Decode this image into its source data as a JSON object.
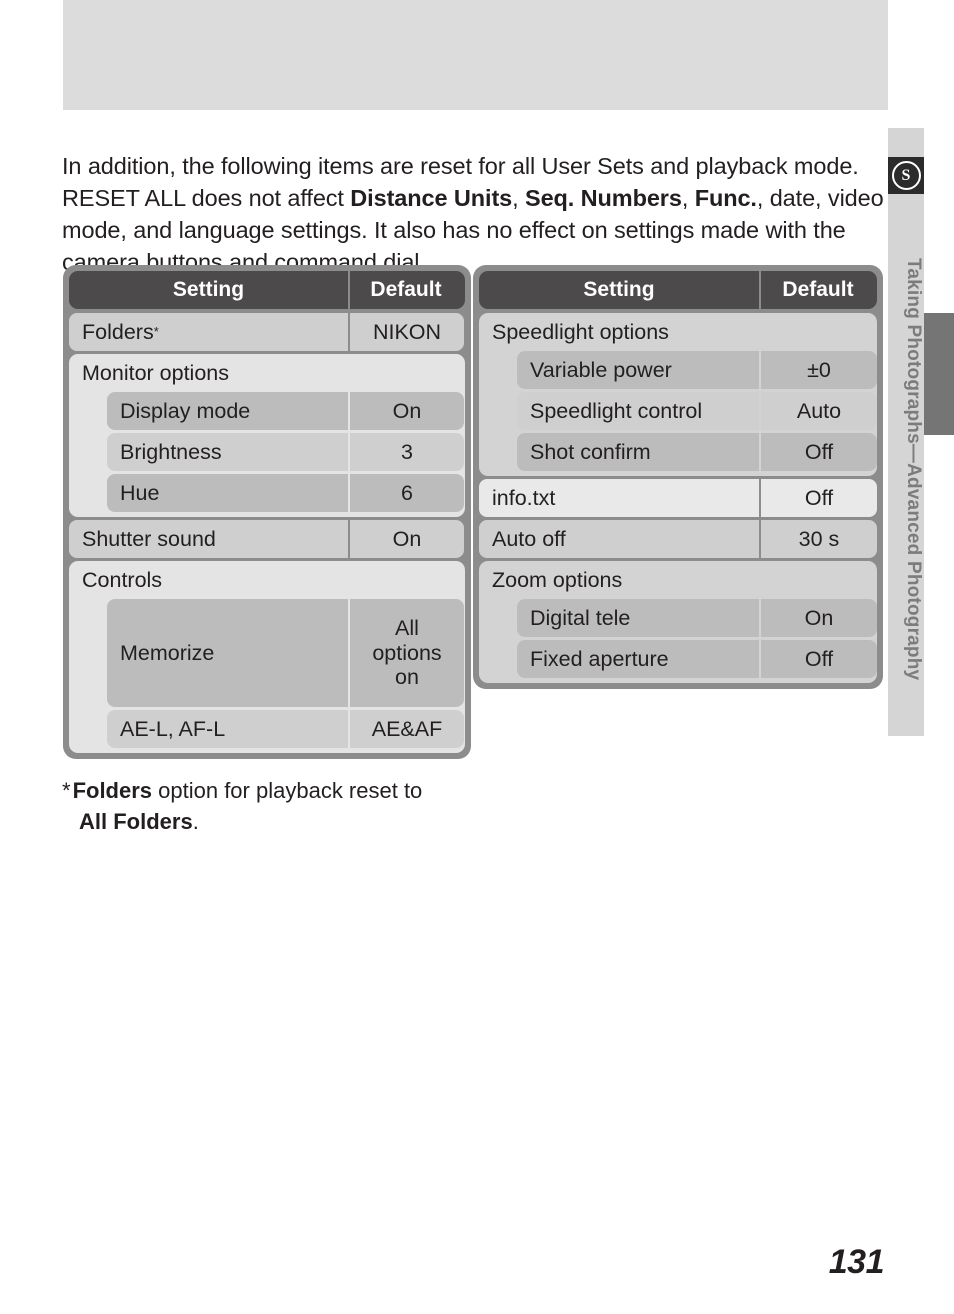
{
  "page": {
    "number": "131",
    "side_tab": {
      "icon": "shutter-s-icon",
      "icon_glyph": "S",
      "label": "Taking Photographs—Advanced Photography"
    }
  },
  "intro": {
    "seg1": "In addition, the following items are reset for all User Sets and playback mode. RESET ALL does not affect ",
    "bold1": "Distance Units",
    "seg2": ", ",
    "bold2": "Seq. Numbers",
    "seg3": ", ",
    "bold3": "Func.",
    "seg4": ", date, video mode, and language settings.  It also has no effect on settings made with the camera buttons and command dial."
  },
  "footnote": {
    "star": "*",
    "bold1": "Folders",
    "text1": " option for playback reset to",
    "bold2": "All Folders",
    "text2": "."
  },
  "tables": [
    {
      "id": "left",
      "headers": {
        "setting": "Setting",
        "default": "Default"
      },
      "rows": [
        {
          "kind": "row",
          "label": "Folders",
          "sup": "*",
          "value": "NIKON",
          "shade": "light"
        },
        {
          "kind": "group",
          "title": "Monitor options",
          "shade": "group",
          "children": [
            {
              "label": "Display mode",
              "value": "On",
              "shade": "mid"
            },
            {
              "label": "Brightness",
              "value": "3",
              "shade": "light"
            },
            {
              "label": "Hue",
              "value": "6",
              "shade": "mid"
            }
          ]
        },
        {
          "kind": "row",
          "label": "Shutter sound",
          "value": "On",
          "shade": "light"
        },
        {
          "kind": "group",
          "title": "Controls",
          "shade": "group",
          "children": [
            {
              "label": "Memorize",
              "value": "All options on",
              "shade": "mid",
              "tall": true
            },
            {
              "label": "AE-L, AF-L",
              "value": "AE&AF",
              "shade": "light"
            }
          ]
        }
      ]
    },
    {
      "id": "right",
      "headers": {
        "setting": "Setting",
        "default": "Default"
      },
      "rows": [
        {
          "kind": "group",
          "title": "Speedlight options",
          "shade": "groupB",
          "children": [
            {
              "label": "Variable power",
              "value": "±0",
              "shade": "mid"
            },
            {
              "label": "Speedlight control",
              "value": "Auto",
              "shade": "light"
            },
            {
              "label": "Shot confirm",
              "value": "Off",
              "shade": "mid"
            }
          ]
        },
        {
          "kind": "row",
          "label": "info.txt",
          "value": "Off",
          "shade": "lightest"
        },
        {
          "kind": "row",
          "label": "Auto off",
          "value": "30 s",
          "shade": "light"
        },
        {
          "kind": "group",
          "title": "Zoom options",
          "shade": "groupB",
          "children": [
            {
              "label": "Digital tele",
              "value": "On",
              "shade": "mid"
            },
            {
              "label": "Fixed aperture",
              "value": "Off",
              "shade": "mid"
            }
          ]
        }
      ]
    }
  ]
}
